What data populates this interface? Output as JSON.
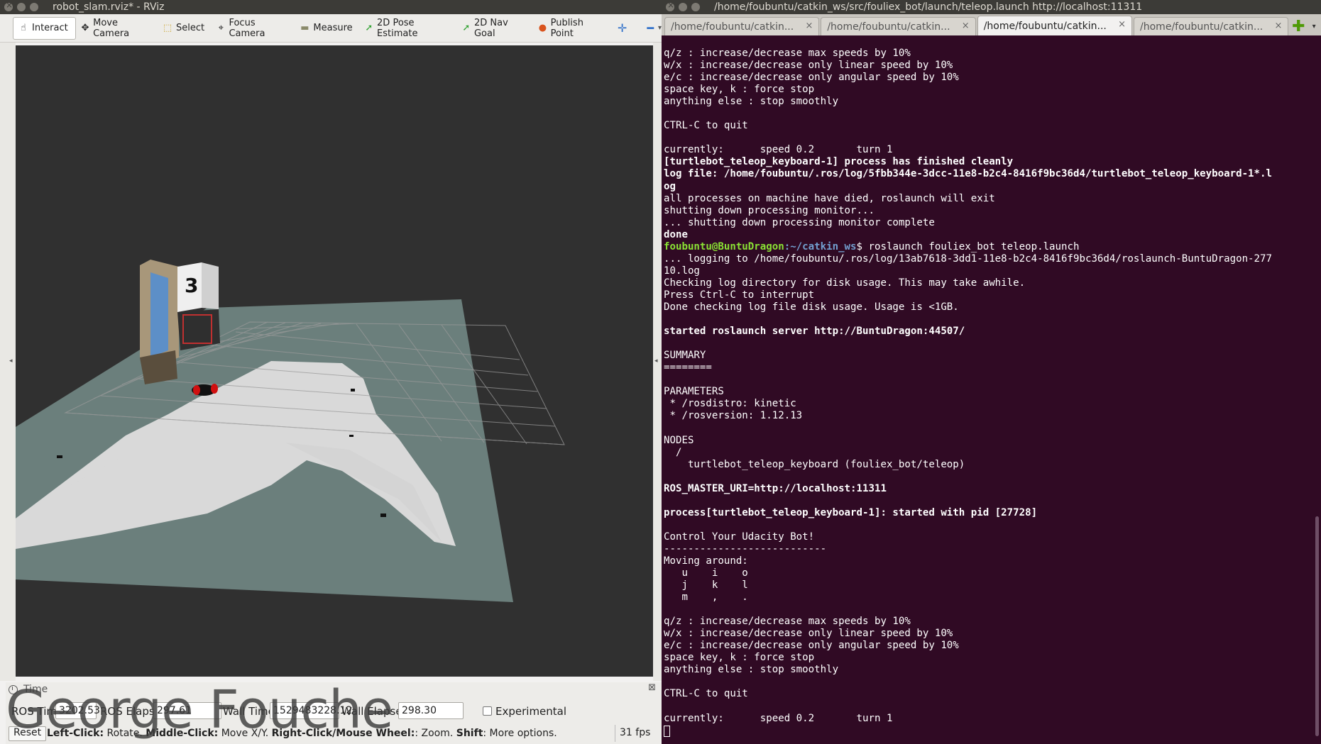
{
  "rviz": {
    "title": "robot_slam.rviz* - RViz",
    "toolbar": [
      {
        "label": "Interact",
        "icon": "hand-icon",
        "glyph": "☝"
      },
      {
        "label": "Move Camera",
        "icon": "move-camera-icon",
        "glyph": "✥"
      },
      {
        "label": "Select",
        "icon": "select-icon",
        "glyph": "⬚"
      },
      {
        "label": "Focus Camera",
        "icon": "focus-camera-icon",
        "glyph": "⌖"
      },
      {
        "label": "Measure",
        "icon": "ruler-icon",
        "glyph": "▬"
      },
      {
        "label": "2D Pose Estimate",
        "icon": "pose-arrow-icon",
        "glyph": "➚"
      },
      {
        "label": "2D Nav Goal",
        "icon": "nav-goal-arrow-icon",
        "glyph": "➚"
      },
      {
        "label": "Publish Point",
        "icon": "map-pin-icon",
        "glyph": "●"
      }
    ],
    "toolbar_extra": {
      "add": "✛",
      "remove": "━",
      "menu": "▾"
    },
    "scene_box_label": "3",
    "time_panel": {
      "title": "Time",
      "close": "⊠",
      "ros_time_label": "ROS Time:",
      "ros_time": "3202.53",
      "ros_elapsed_label": "ROS Elapsed:",
      "ros_elapsed": "297.61",
      "wall_time_label": "Wall Time:",
      "wall_time": "1529483228.12",
      "wall_elapsed_label": "Wall Elapsed:",
      "wall_elapsed": "298.30",
      "experimental_label": "Experimental"
    },
    "status": {
      "reset": "Reset",
      "left_click": "Left-Click:",
      "left_click_desc": " Rotate. ",
      "middle_click": "Middle-Click:",
      "middle_click_desc": " Move X/Y. ",
      "right_click": "Right-Click/Mouse Wheel:",
      "right_click_desc": ": Zoom. ",
      "shift": "Shift",
      "shift_desc": ": More options.",
      "fps": "31 fps"
    },
    "watermark": "George Fouche"
  },
  "terminal": {
    "title": "/home/foubuntu/catkin_ws/src/fouliex_bot/launch/teleop.launch http://localhost:11311",
    "tabs": [
      {
        "label": "/home/foubuntu/catkin..."
      },
      {
        "label": "/home/foubuntu/catkin..."
      },
      {
        "label": "/home/foubuntu/catkin..."
      },
      {
        "label": "/home/foubuntu/catkin..."
      }
    ],
    "tab_add": "✚",
    "tab_menu": "▾",
    "close_glyph": "×",
    "prompt_user": "foubuntu@BuntuDragon",
    "prompt_path": ":~/catkin_ws",
    "prompt_cmd": "$ roslaunch fouliex_bot teleop.launch",
    "lines_before": [
      {
        "t": "q/z : increase/decrease max speeds by 10%",
        "b": false
      },
      {
        "t": "w/x : increase/decrease only linear speed by 10%",
        "b": false
      },
      {
        "t": "e/c : increase/decrease only angular speed by 10%",
        "b": false
      },
      {
        "t": "space key, k : force stop",
        "b": false
      },
      {
        "t": "anything else : stop smoothly",
        "b": false
      },
      {
        "t": "",
        "b": false
      },
      {
        "t": "CTRL-C to quit",
        "b": false
      },
      {
        "t": "",
        "b": false
      },
      {
        "t": "currently:      speed 0.2       turn 1",
        "b": false
      },
      {
        "t": "[turtlebot_teleop_keyboard-1] process has finished cleanly",
        "b": true
      },
      {
        "t": "log file: /home/foubuntu/.ros/log/5fbb344e-3dcc-11e8-b2c4-8416f9bc36d4/turtlebot_teleop_keyboard-1*.l",
        "b": true
      },
      {
        "t": "og",
        "b": true
      },
      {
        "t": "all processes on machine have died, roslaunch will exit",
        "b": false
      },
      {
        "t": "shutting down processing monitor...",
        "b": false
      },
      {
        "t": "... shutting down processing monitor complete",
        "b": false
      },
      {
        "t": "done",
        "b": true
      }
    ],
    "lines_after": [
      {
        "t": "... logging to /home/foubuntu/.ros/log/13ab7618-3dd1-11e8-b2c4-8416f9bc36d4/roslaunch-BuntuDragon-277",
        "b": false
      },
      {
        "t": "10.log",
        "b": false
      },
      {
        "t": "Checking log directory for disk usage. This may take awhile.",
        "b": false
      },
      {
        "t": "Press Ctrl-C to interrupt",
        "b": false
      },
      {
        "t": "Done checking log file disk usage. Usage is <1GB.",
        "b": false
      },
      {
        "t": "",
        "b": false
      },
      {
        "t": "started roslaunch server http://BuntuDragon:44507/",
        "b": true
      },
      {
        "t": "",
        "b": false
      },
      {
        "t": "SUMMARY",
        "b": false
      },
      {
        "t": "========",
        "b": false
      },
      {
        "t": "",
        "b": false
      },
      {
        "t": "PARAMETERS",
        "b": false
      },
      {
        "t": " * /rosdistro: kinetic",
        "b": false
      },
      {
        "t": " * /rosversion: 1.12.13",
        "b": false
      },
      {
        "t": "",
        "b": false
      },
      {
        "t": "NODES",
        "b": false
      },
      {
        "t": "  /",
        "b": false
      },
      {
        "t": "    turtlebot_teleop_keyboard (fouliex_bot/teleop)",
        "b": false
      },
      {
        "t": "",
        "b": false
      },
      {
        "t": "ROS_MASTER_URI=http://localhost:11311",
        "b": true
      },
      {
        "t": "",
        "b": false
      },
      {
        "t": "process[turtlebot_teleop_keyboard-1]: started with pid [27728]",
        "b": true
      },
      {
        "t": "",
        "b": false
      },
      {
        "t": "Control Your Udacity Bot!",
        "b": false
      },
      {
        "t": "---------------------------",
        "b": false
      },
      {
        "t": "Moving around:",
        "b": false
      },
      {
        "t": "   u    i    o",
        "b": false
      },
      {
        "t": "   j    k    l",
        "b": false
      },
      {
        "t": "   m    ,    .",
        "b": false
      },
      {
        "t": "",
        "b": false
      },
      {
        "t": "q/z : increase/decrease max speeds by 10%",
        "b": false
      },
      {
        "t": "w/x : increase/decrease only linear speed by 10%",
        "b": false
      },
      {
        "t": "e/c : increase/decrease only angular speed by 10%",
        "b": false
      },
      {
        "t": "space key, k : force stop",
        "b": false
      },
      {
        "t": "anything else : stop smoothly",
        "b": false
      },
      {
        "t": "",
        "b": false
      },
      {
        "t": "CTRL-C to quit",
        "b": false
      },
      {
        "t": "",
        "b": false
      },
      {
        "t": "currently:      speed 0.2       turn 1",
        "b": false
      }
    ]
  },
  "colors": {
    "terminal_bg": "#300a24",
    "prompt_user": "#8ae234",
    "prompt_path": "#729fcf",
    "viewport_bg": "#303030",
    "map_free": "#d9d9d9",
    "map_unknown": "#6b7f7c"
  }
}
